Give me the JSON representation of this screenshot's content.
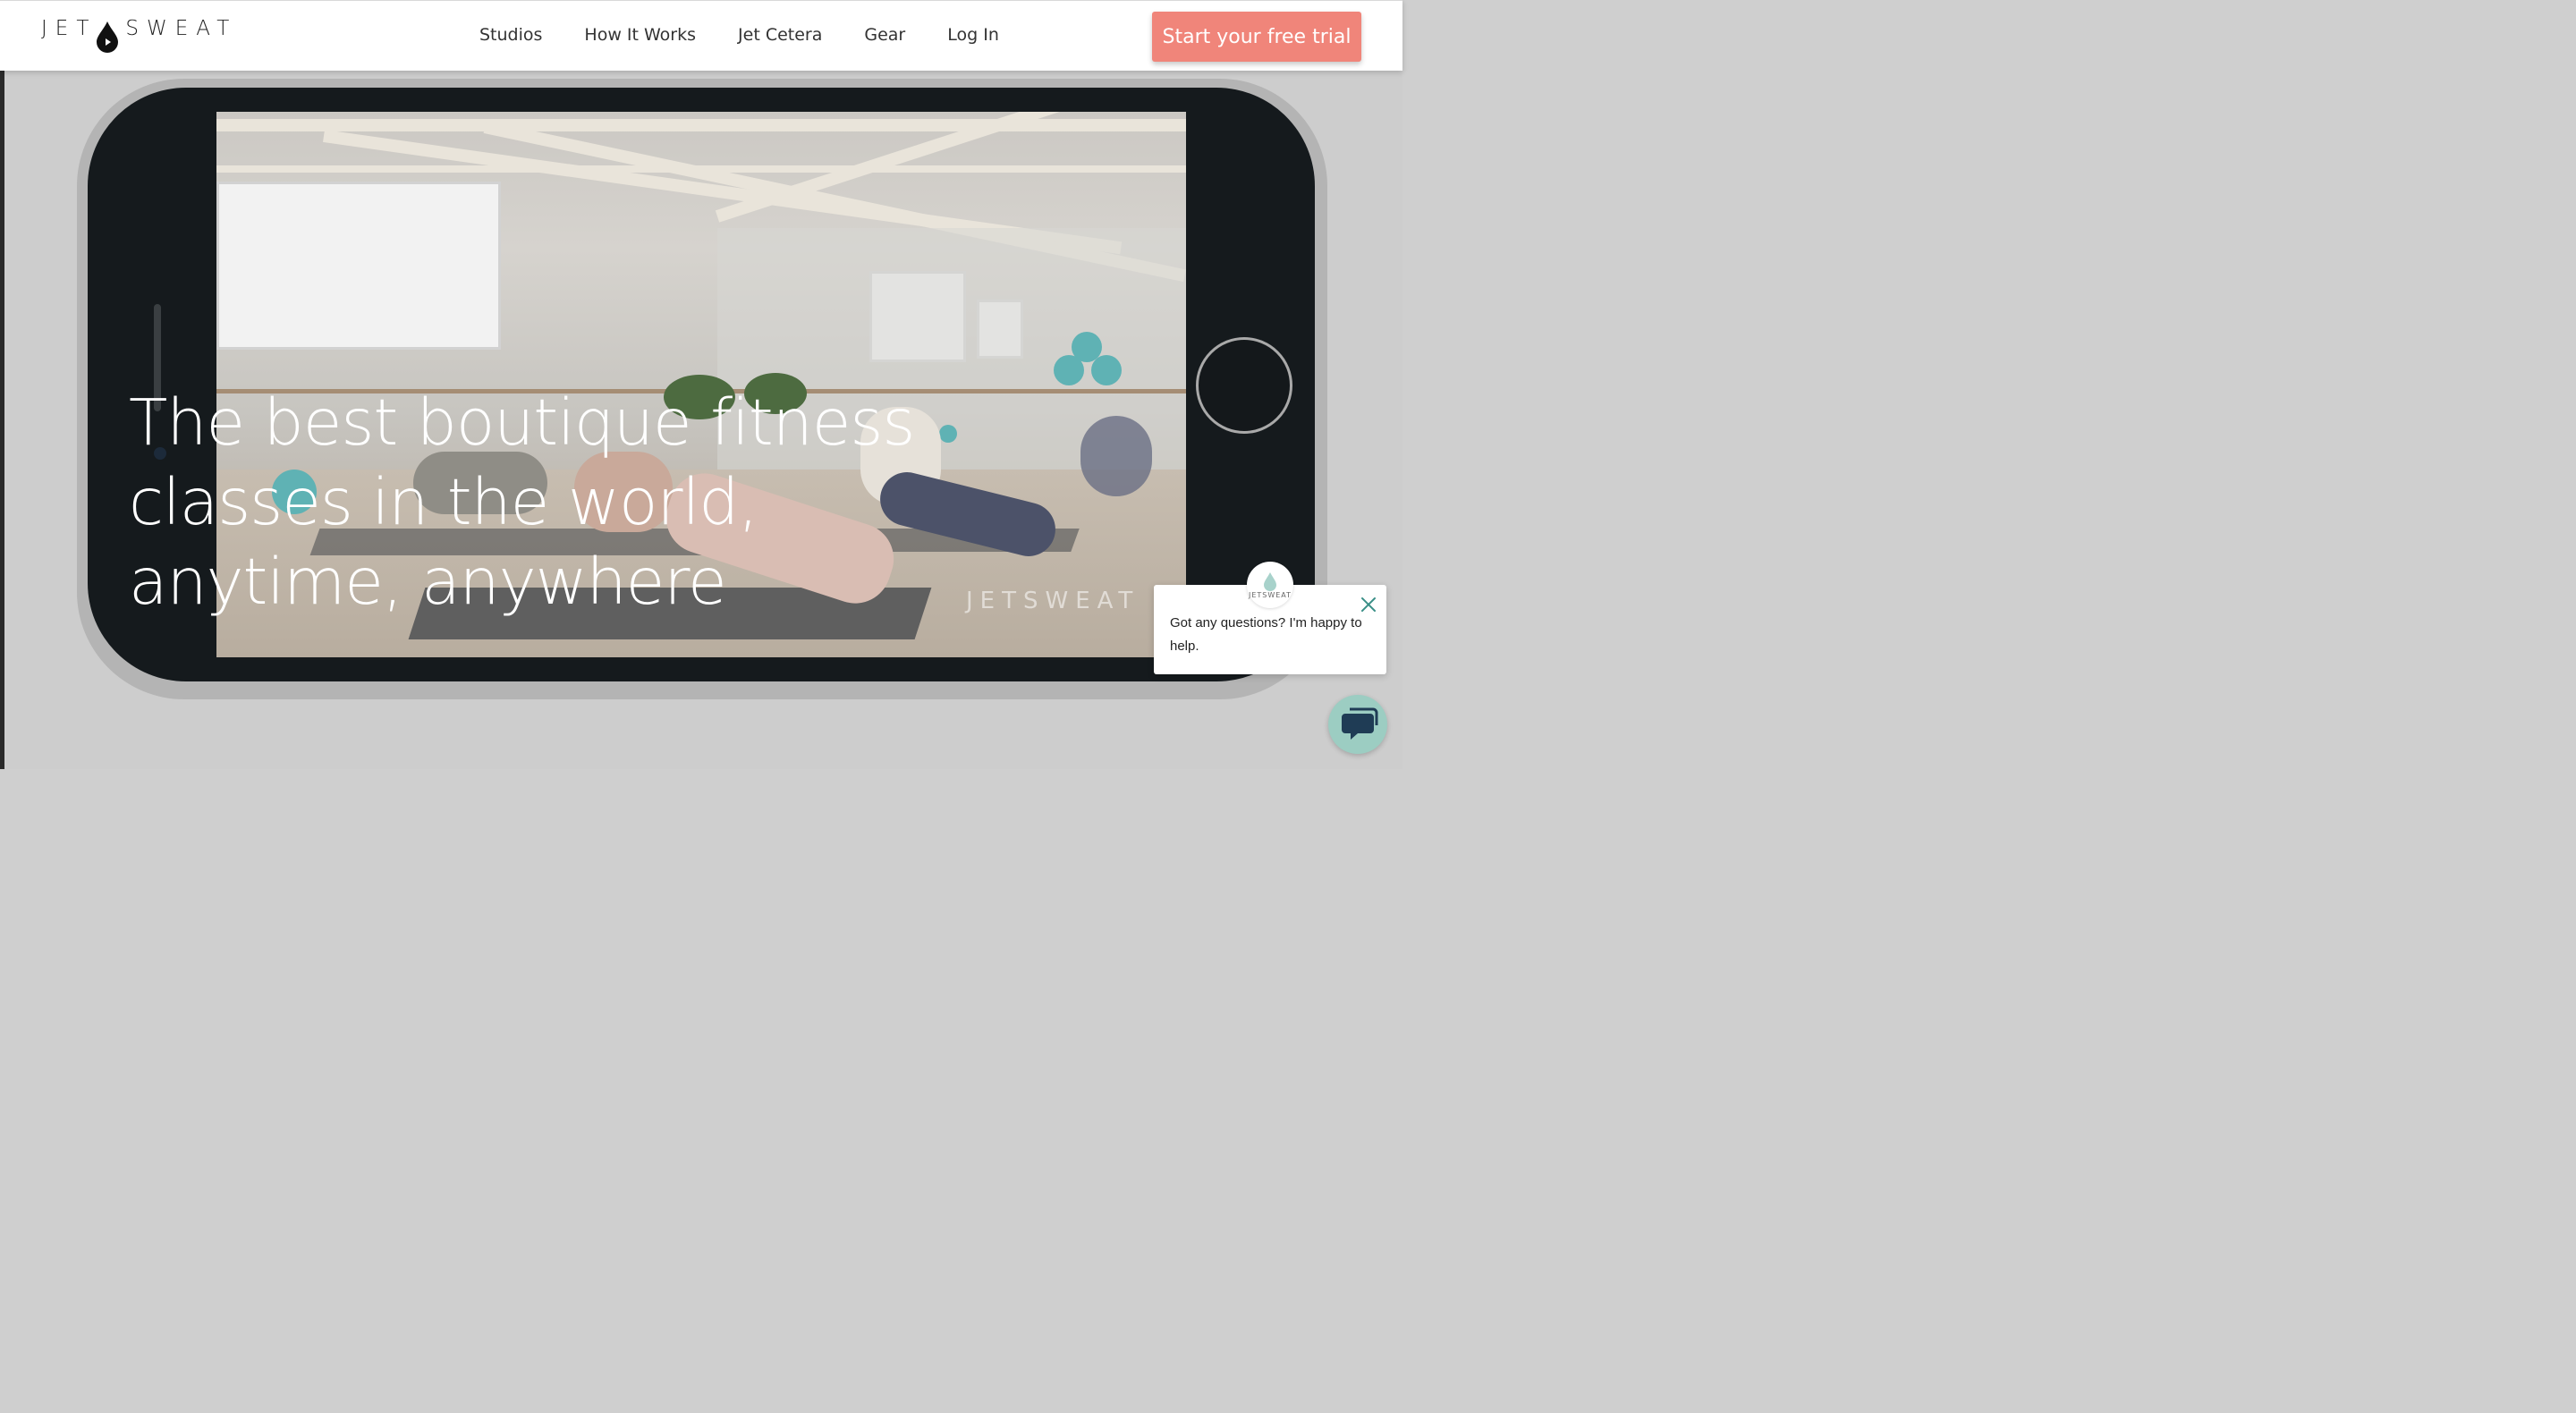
{
  "header": {
    "logo_text_left": "JET",
    "logo_text_right": "SWEAT",
    "nav": [
      {
        "label": "Studios"
      },
      {
        "label": "How It Works"
      },
      {
        "label": "Jet Cetera"
      },
      {
        "label": "Gear"
      },
      {
        "label": "Log In"
      }
    ],
    "cta_label": "Start your free trial"
  },
  "hero": {
    "headline": "The best boutique fitness classes in the world, anytime, anywhere",
    "video_watermark": "JETSWEAT"
  },
  "chat": {
    "avatar_label": "JETSWEAT",
    "message": "Got any questions? I'm happy to help.",
    "close_icon": "close-icon",
    "launcher_icon": "chat-bubble-icon"
  },
  "colors": {
    "cta": "#f0857a",
    "chat_launcher": "#9ccdc2",
    "phone_body": "#151a1d",
    "accent_teal": "#5fb2b4"
  }
}
